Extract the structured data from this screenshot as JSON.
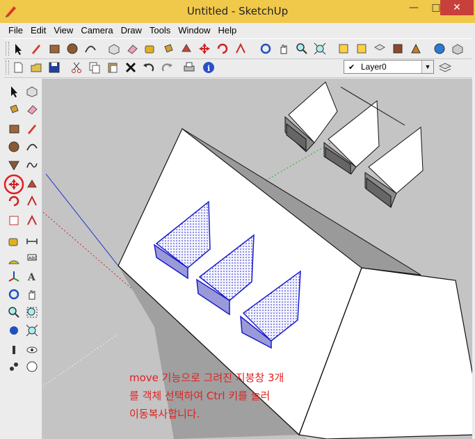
{
  "window": {
    "title": "Untitled - SketchUp",
    "minimize": "—",
    "maximize": "□",
    "close": "✕"
  },
  "menu": [
    "File",
    "Edit",
    "View",
    "Camera",
    "Draw",
    "Tools",
    "Window",
    "Help"
  ],
  "layers": {
    "current": "Layer0",
    "check": "✔"
  },
  "toolbar_top": [
    "select-icon",
    "pencil-icon",
    "rectangle-icon",
    "circle-icon",
    "arc-icon",
    "make-component-icon",
    "eraser-icon",
    "tape-measure-icon",
    "paint-bucket-icon",
    "push-pull-icon",
    "move-icon",
    "rotate-icon",
    "follow-me-icon",
    "orbit-icon",
    "pan-icon",
    "zoom-icon",
    "zoom-extents-icon",
    "previous-view-icon",
    "next-view-icon",
    "add-location-icon",
    "get-models-icon",
    "share-model-icon",
    "components-icon",
    "extension-icon"
  ],
  "toolbar_second": [
    "new-icon",
    "open-icon",
    "save-icon",
    "cut-icon",
    "copy-icon",
    "paste-icon",
    "erase-icon",
    "undo-icon",
    "redo-icon",
    "print-icon",
    "model-info-icon"
  ],
  "toolbar_left": [
    "select-icon",
    "make-component-icon",
    "paint-bucket-icon",
    "eraser-icon",
    "rectangle-icon",
    "line-icon",
    "circle-icon",
    "arc-icon",
    "polygon-icon",
    "freehand-icon",
    "move-icon",
    "push-pull-icon",
    "rotate-icon",
    "follow-me-icon",
    "scale-icon",
    "offset-icon",
    "tape-measure-icon",
    "dimension-icon",
    "protractor-icon",
    "text-icon",
    "axes-icon",
    "3d-text-icon",
    "orbit-icon",
    "pan-icon",
    "zoom-icon",
    "zoom-window-icon",
    "previous-icon",
    "zoom-extents-icon",
    "walk-icon",
    "look-around-icon",
    "position-camera-icon",
    "section-plane-icon"
  ],
  "annotation": {
    "line1": "move 기능으로 그려진 지붕창 3개",
    "line2": "를 객체 선택하여 Ctrl 키를 눌러",
    "line3": "이동복사합니다."
  },
  "colors": {
    "titlebar": "#f0c84a",
    "close": "#c7403a",
    "annotation": "#e02020",
    "selection": "#1a1acc",
    "active_tool_ring": "#e02020"
  }
}
